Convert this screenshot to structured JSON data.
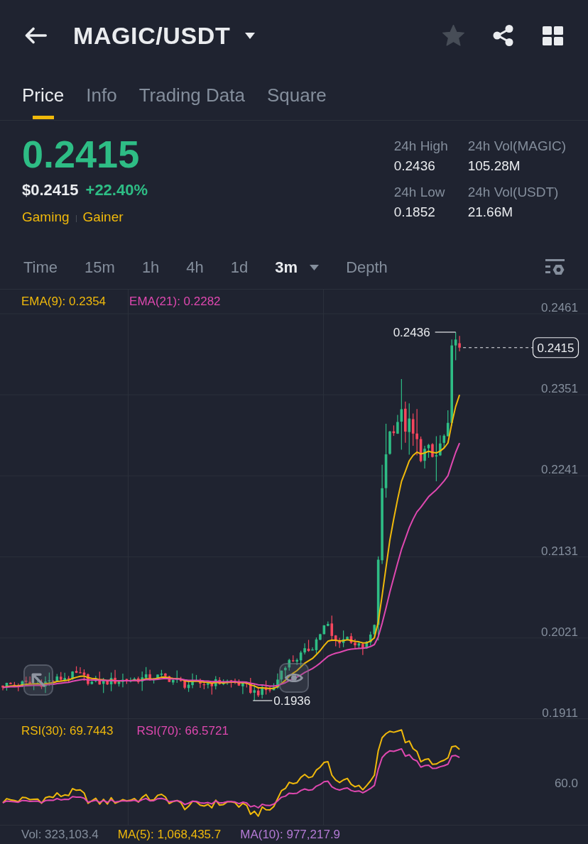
{
  "header": {
    "title": "MAGIC/USDT",
    "favorite": false
  },
  "tabs": [
    {
      "label": "Price",
      "selected": true
    },
    {
      "label": "Info",
      "selected": false
    },
    {
      "label": "Trading Data",
      "selected": false
    },
    {
      "label": "Square",
      "selected": false
    }
  ],
  "ticker": {
    "last_price": "0.2415",
    "fiat_price": "$0.2415",
    "change": "+22.40%",
    "tags": [
      "Gaming",
      "Gainer"
    ]
  },
  "stats": [
    {
      "label": "24h High",
      "value": "0.2436"
    },
    {
      "label": "24h Vol(MAGIC)",
      "value": "105.28M"
    },
    {
      "label": "24h Low",
      "value": "0.1852"
    },
    {
      "label": "24h Vol(USDT)",
      "value": "21.66M"
    }
  ],
  "intervals": [
    {
      "label": "Time",
      "selected": false,
      "dropdown": false
    },
    {
      "label": "15m",
      "selected": false,
      "dropdown": false
    },
    {
      "label": "1h",
      "selected": false,
      "dropdown": false
    },
    {
      "label": "4h",
      "selected": false,
      "dropdown": false
    },
    {
      "label": "1d",
      "selected": false,
      "dropdown": false
    },
    {
      "label": "3m",
      "selected": true,
      "dropdown": true
    },
    {
      "label": "Depth",
      "selected": false,
      "dropdown": false
    }
  ],
  "chart": {
    "indicators": [
      {
        "label": "EMA(9): 0.2354",
        "color": "#f0b90b"
      },
      {
        "label": "EMA(21): 0.2282",
        "color": "#df48b0"
      }
    ],
    "price_axis": [
      "0.2461",
      "0.2351",
      "0.2241",
      "0.2131",
      "0.2021",
      "0.1911"
    ],
    "high_label": "0.2436",
    "low_label": "0.1936",
    "last_price_tag": "0.2415"
  },
  "rsi": {
    "indicators": [
      {
        "label": "RSI(30): 69.7443",
        "color": "#f0b90b"
      },
      {
        "label": "RSI(70): 66.5721",
        "color": "#df48b0"
      }
    ],
    "axis_label": "60.0"
  },
  "volume": {
    "indicators": [
      {
        "label": "Vol: 323,103.4",
        "color": "#848e9c"
      },
      {
        "label": "MA(5): 1,068,435.7",
        "color": "#f0b90b"
      },
      {
        "label": "MA(10): 977,217.9",
        "color": "#b57bd6"
      }
    ]
  }
}
